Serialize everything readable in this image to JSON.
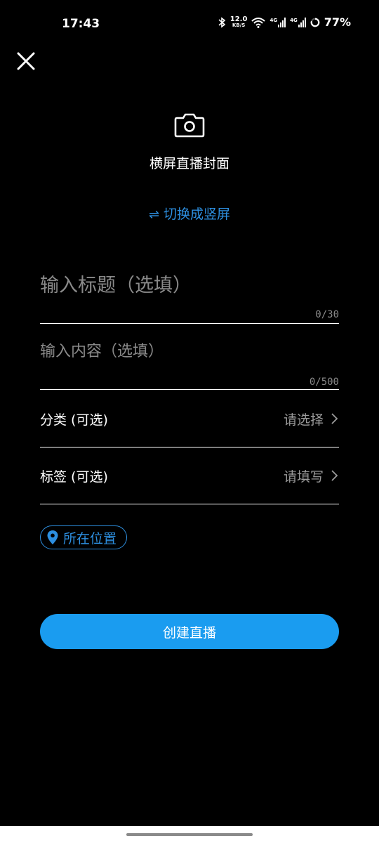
{
  "status_bar": {
    "time": "17:43",
    "net_speed_value": "12.0",
    "net_speed_unit": "KB/S",
    "signal1_label": "4G",
    "signal2_label": "4G",
    "battery": "77%"
  },
  "cover": {
    "label": "横屏直播封面",
    "switch_label": "切换成竖屏",
    "switch_icon": "⇌"
  },
  "title_input": {
    "placeholder": "输入标题（选填）",
    "counter": "0/30"
  },
  "content_input": {
    "placeholder": "输入内容（选填）",
    "counter": "0/500"
  },
  "category": {
    "label": "分类 (可选)",
    "value": "请选择"
  },
  "tags": {
    "label": "标签 (可选)",
    "value": "请填写"
  },
  "location": {
    "label": "所在位置"
  },
  "create_button": {
    "label": "创建直播"
  },
  "colors": {
    "accent": "#1a9cf0",
    "link": "#2d8fe0",
    "background": "#000000"
  },
  "icons": [
    "close-icon",
    "camera-icon",
    "swap-arrows-icon",
    "chevron-right-icon",
    "location-pin-icon",
    "bluetooth-icon",
    "wifi-icon",
    "battery-icon"
  ]
}
